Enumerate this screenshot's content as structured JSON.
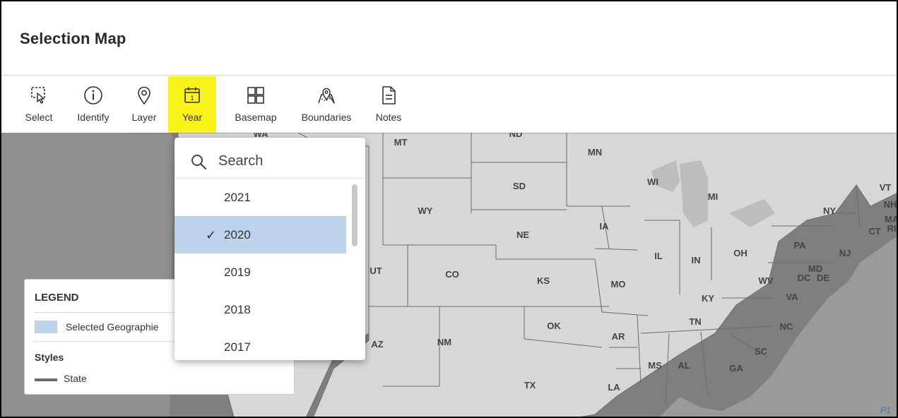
{
  "header": {
    "title": "Selection Map"
  },
  "toolbar": {
    "items": [
      {
        "label": "Select",
        "icon": "select-area-icon"
      },
      {
        "label": "Identify",
        "icon": "info-icon"
      },
      {
        "label": "Layer",
        "icon": "map-pin-icon"
      },
      {
        "label": "Year",
        "icon": "calendar-icon",
        "calendar_day": "1",
        "active": true
      },
      {
        "label": "Basemap",
        "icon": "grid-icon"
      },
      {
        "label": "Boundaries",
        "icon": "map-boundaries-icon"
      },
      {
        "label": "Notes",
        "icon": "note-icon"
      }
    ]
  },
  "year_dropdown": {
    "search_placeholder": "Search",
    "years": [
      "2021",
      "2020",
      "2019",
      "2018",
      "2017"
    ],
    "selected": "2020",
    "check_glyph": "✓"
  },
  "legend": {
    "title": "LEGEND",
    "selected_label": "Selected Geographie",
    "styles_title": "Styles",
    "state_label": "State"
  },
  "map": {
    "state_labels": [
      "WA",
      "MT",
      "ND",
      "MN",
      "SD",
      "WI",
      "MI",
      "VT",
      "NH",
      "MA",
      "CT",
      "RI",
      "NY",
      "WY",
      "IA",
      "NE",
      "PA",
      "NJ",
      "IL",
      "IN",
      "OH",
      "UT",
      "CO",
      "KS",
      "MO",
      "WV",
      "MD",
      "DC",
      "DE",
      "KY",
      "VA",
      "TN",
      "NC",
      "OK",
      "AR",
      "AZ",
      "NM",
      "SC",
      "MS",
      "AL",
      "GA",
      "TX",
      "LA"
    ]
  },
  "corner_text": "P1",
  "colors": {
    "highlight": "#fbf21c",
    "selected": "#bdd3ec",
    "land": "#d6d6d6",
    "water": "#8a8a8a"
  }
}
